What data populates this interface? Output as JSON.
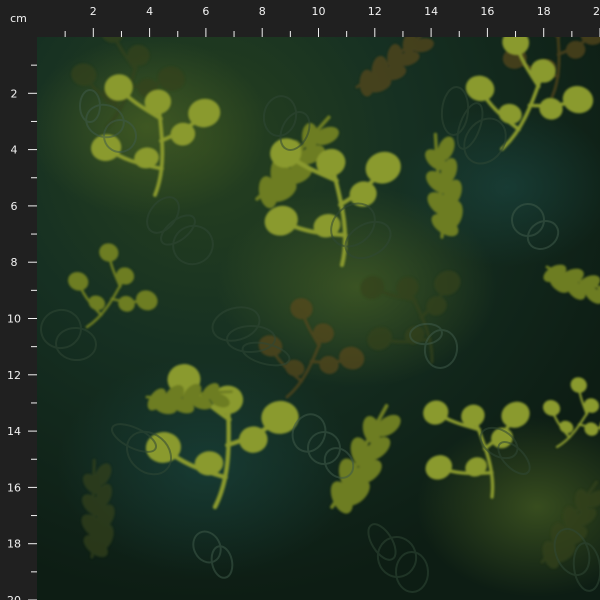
{
  "ruler": {
    "unit_label": "cm",
    "top_labels": [
      "2",
      "4",
      "6",
      "8",
      "10",
      "12",
      "14",
      "16",
      "18",
      "20"
    ],
    "left_labels": [
      "2",
      "4",
      "6",
      "8",
      "10",
      "12",
      "14",
      "16",
      "18",
      "20"
    ]
  },
  "colors": {
    "ruler_background": "#202020",
    "ruler_text": "#f2f2f2",
    "fabric_background": "#132417",
    "leaf_light": "#8a9a2f",
    "leaf_mid": "#6d7d24",
    "leaf_dark": "#34431c",
    "leaf_brown": "#5a4a1d",
    "fabric_shadow": "#0f1d14"
  }
}
